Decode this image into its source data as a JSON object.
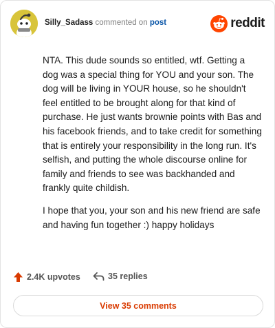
{
  "comment": {
    "username": "Silly_Sadass",
    "action_text": "commented on",
    "target_link": "post",
    "brand_name": "reddit",
    "paragraphs": [
      "NTA. This dude sounds so entitled, wtf. Getting a dog was a special thing for YOU and your son. The dog will be living in YOUR house, so he shouldn't feel entitled to be brought along for that kind of purchase. He just wants brownie points with Bas and his facebook friends, and to take credit for something that is entirely your responsibility in the long run. It's selfish, and putting the whole discourse online for family and friends to see was backhanded and frankly quite childish.",
      "I hope that you, your son and his new friend are safe and having fun together :) happy holidays"
    ]
  },
  "footer": {
    "upvotes_label": "2.4K upvotes",
    "replies_label": "35 replies",
    "view_button_label": "View 35 comments"
  },
  "icons": {
    "upvote": "upvote-arrow-icon",
    "reply": "reply-arrow-icon",
    "brand": "reddit-snoo-icon",
    "avatar": "snoo-avatar"
  },
  "colors": {
    "accent": "#d93a00",
    "brand_orange": "#ff4500",
    "link": "#0a56a8",
    "avatar_bg": "#d8c43a"
  }
}
